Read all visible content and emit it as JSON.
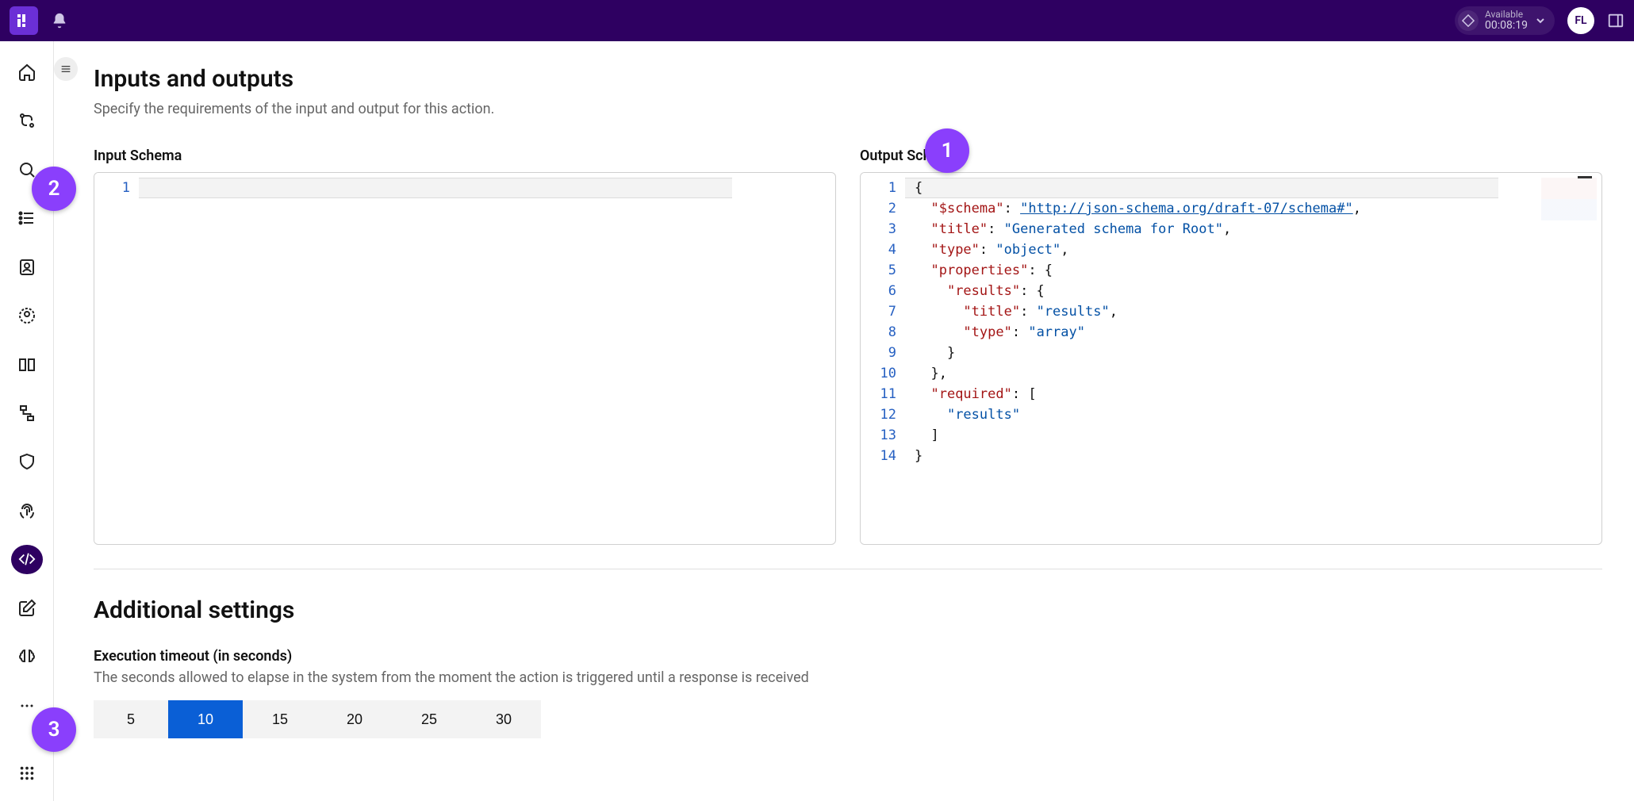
{
  "header": {
    "status_label": "Available",
    "status_time": "00:08:19",
    "avatar_initials": "FL"
  },
  "page": {
    "title": "Inputs and outputs",
    "subtitle": "Specify the requirements of the input and output for this action.",
    "input_schema_label": "Input Schema",
    "output_schema_label": "Output Schema",
    "additional_title": "Additional settings",
    "timeout_label": "Execution timeout (in seconds)",
    "timeout_desc": "The seconds allowed to elapse in the system from the moment the action is triggered until a response is received"
  },
  "input_schema": {
    "lines": [
      ""
    ]
  },
  "output_schema": {
    "tokens": [
      [
        {
          "t": "pun",
          "v": "{"
        }
      ],
      [
        {
          "t": "pun",
          "v": "  "
        },
        {
          "t": "key",
          "v": "\"$schema\""
        },
        {
          "t": "pun",
          "v": ": "
        },
        {
          "t": "url",
          "v": "\"http://json-schema.org/draft-07/schema#\""
        },
        {
          "t": "pun",
          "v": ","
        }
      ],
      [
        {
          "t": "pun",
          "v": "  "
        },
        {
          "t": "key",
          "v": "\"title\""
        },
        {
          "t": "pun",
          "v": ": "
        },
        {
          "t": "str",
          "v": "\"Generated schema for Root\""
        },
        {
          "t": "pun",
          "v": ","
        }
      ],
      [
        {
          "t": "pun",
          "v": "  "
        },
        {
          "t": "key",
          "v": "\"type\""
        },
        {
          "t": "pun",
          "v": ": "
        },
        {
          "t": "str",
          "v": "\"object\""
        },
        {
          "t": "pun",
          "v": ","
        }
      ],
      [
        {
          "t": "pun",
          "v": "  "
        },
        {
          "t": "key",
          "v": "\"properties\""
        },
        {
          "t": "pun",
          "v": ": {"
        }
      ],
      [
        {
          "t": "pun",
          "v": "    "
        },
        {
          "t": "key",
          "v": "\"results\""
        },
        {
          "t": "pun",
          "v": ": {"
        }
      ],
      [
        {
          "t": "pun",
          "v": "      "
        },
        {
          "t": "key",
          "v": "\"title\""
        },
        {
          "t": "pun",
          "v": ": "
        },
        {
          "t": "str",
          "v": "\"results\""
        },
        {
          "t": "pun",
          "v": ","
        }
      ],
      [
        {
          "t": "pun",
          "v": "      "
        },
        {
          "t": "key",
          "v": "\"type\""
        },
        {
          "t": "pun",
          "v": ": "
        },
        {
          "t": "str",
          "v": "\"array\""
        }
      ],
      [
        {
          "t": "pun",
          "v": "    }"
        }
      ],
      [
        {
          "t": "pun",
          "v": "  },"
        }
      ],
      [
        {
          "t": "pun",
          "v": "  "
        },
        {
          "t": "key",
          "v": "\"required\""
        },
        {
          "t": "pun",
          "v": ": ["
        }
      ],
      [
        {
          "t": "pun",
          "v": "    "
        },
        {
          "t": "str",
          "v": "\"results\""
        }
      ],
      [
        {
          "t": "pun",
          "v": "  ]"
        }
      ],
      [
        {
          "t": "pun",
          "v": "}"
        }
      ]
    ]
  },
  "timeout_options": [
    "5",
    "10",
    "15",
    "20",
    "25",
    "30"
  ],
  "timeout_selected": "10",
  "callouts": {
    "1": "1",
    "2": "2",
    "3": "3"
  }
}
